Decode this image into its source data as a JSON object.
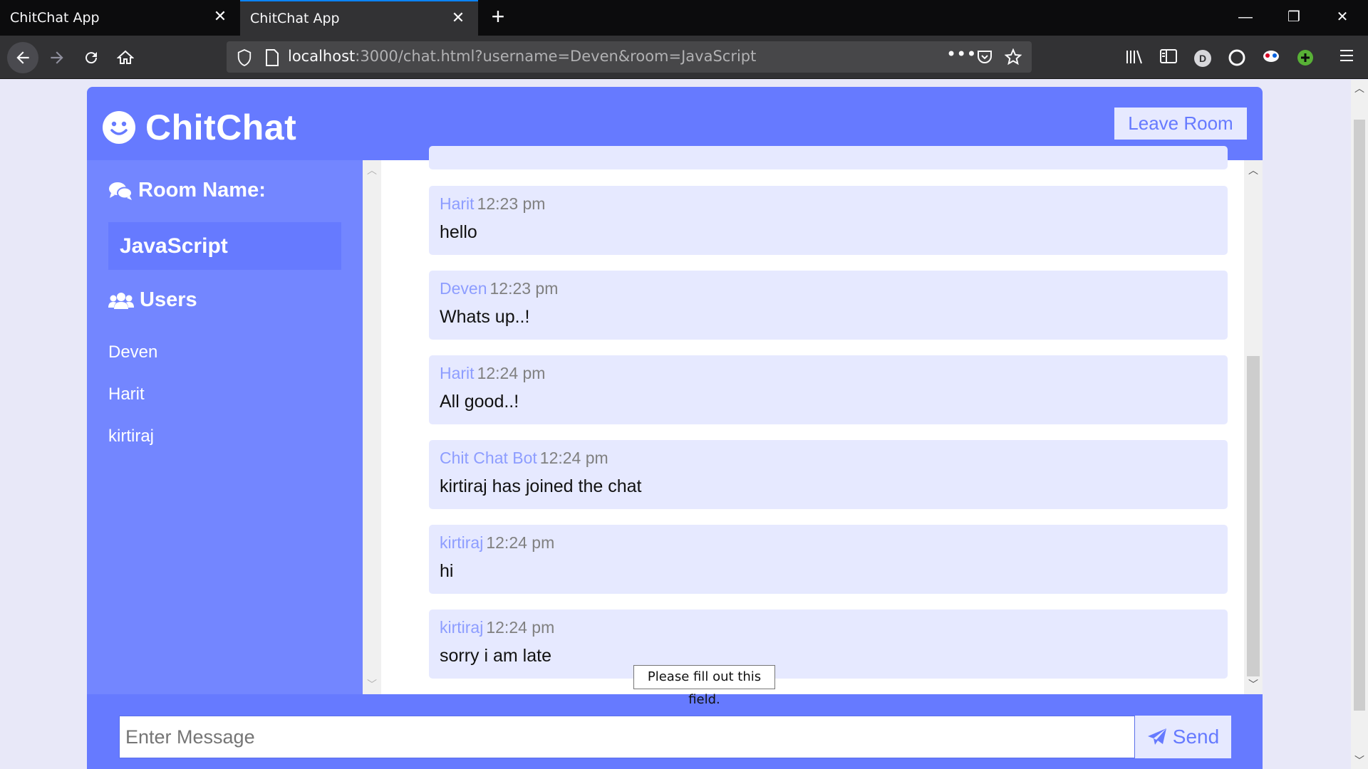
{
  "browser": {
    "tabs": [
      {
        "title": "ChitChat App",
        "active": false
      },
      {
        "title": "ChitChat App",
        "active": true
      }
    ],
    "url_host": "localhost",
    "url_rest": ":3000/chat.html?username=Deven&room=JavaScript",
    "profile_letter": "D",
    "window_controls": {
      "minimize": "—",
      "restore": "❐",
      "close": "✕"
    }
  },
  "app": {
    "title": "ChitChat",
    "leave_label": "Leave Room",
    "room_heading": "Room Name:",
    "room_name": "JavaScript",
    "users_heading": "Users",
    "users": [
      "Deven",
      "Harit",
      "kirtiraj"
    ],
    "messages": [
      {
        "user": "Harit",
        "time": "12:23 pm",
        "text": "hello"
      },
      {
        "user": "Deven",
        "time": "12:23 pm",
        "text": "Whats up..!"
      },
      {
        "user": "Harit",
        "time": "12:24 pm",
        "text": "All good..!"
      },
      {
        "user": "Chit Chat Bot",
        "time": "12:24 pm",
        "text": "kirtiraj has joined the chat"
      },
      {
        "user": "kirtiraj",
        "time": "12:24 pm",
        "text": "hi"
      },
      {
        "user": "kirtiraj",
        "time": "12:24 pm",
        "text": "sorry i am late"
      }
    ],
    "input_placeholder": "Enter Message",
    "send_label": "Send",
    "validation_tooltip": "Please fill out this field."
  },
  "colors": {
    "primary": "#667aff",
    "sidebar": "#7386ff",
    "light": "#e6e9ff",
    "username": "#8d9dff"
  }
}
